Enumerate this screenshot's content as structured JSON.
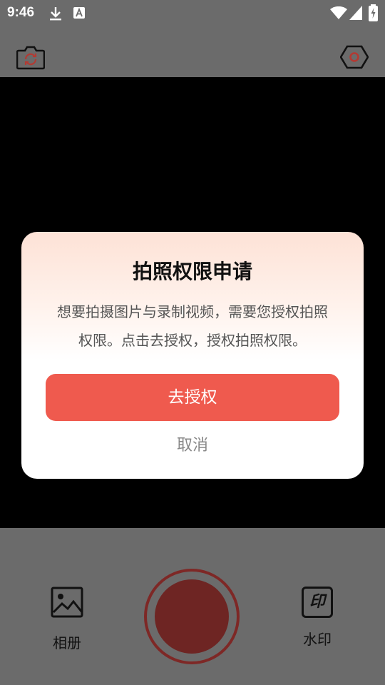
{
  "status_bar": {
    "time": "9:46",
    "icons": [
      "download-icon",
      "font-a-icon",
      "wifi-icon",
      "signal-icon",
      "battery-charging-icon"
    ]
  },
  "top_bar": {
    "left_icon": "camera-switch-icon",
    "right_icon": "settings-hexagon-icon",
    "accent": "#ef5a4e"
  },
  "dialog": {
    "title": "拍照权限申请",
    "message": "想要拍摄图片与录制视频，需要您授权拍照权限。点击去授权，授权拍照权限。",
    "confirm_label": "去授权",
    "cancel_label": "取消",
    "confirm_color": "#ef5a4e"
  },
  "bottom_bar": {
    "album_label": "相册",
    "watermark_label": "水印",
    "watermark_icon_text": "印",
    "shutter_color": "#6e2523"
  }
}
